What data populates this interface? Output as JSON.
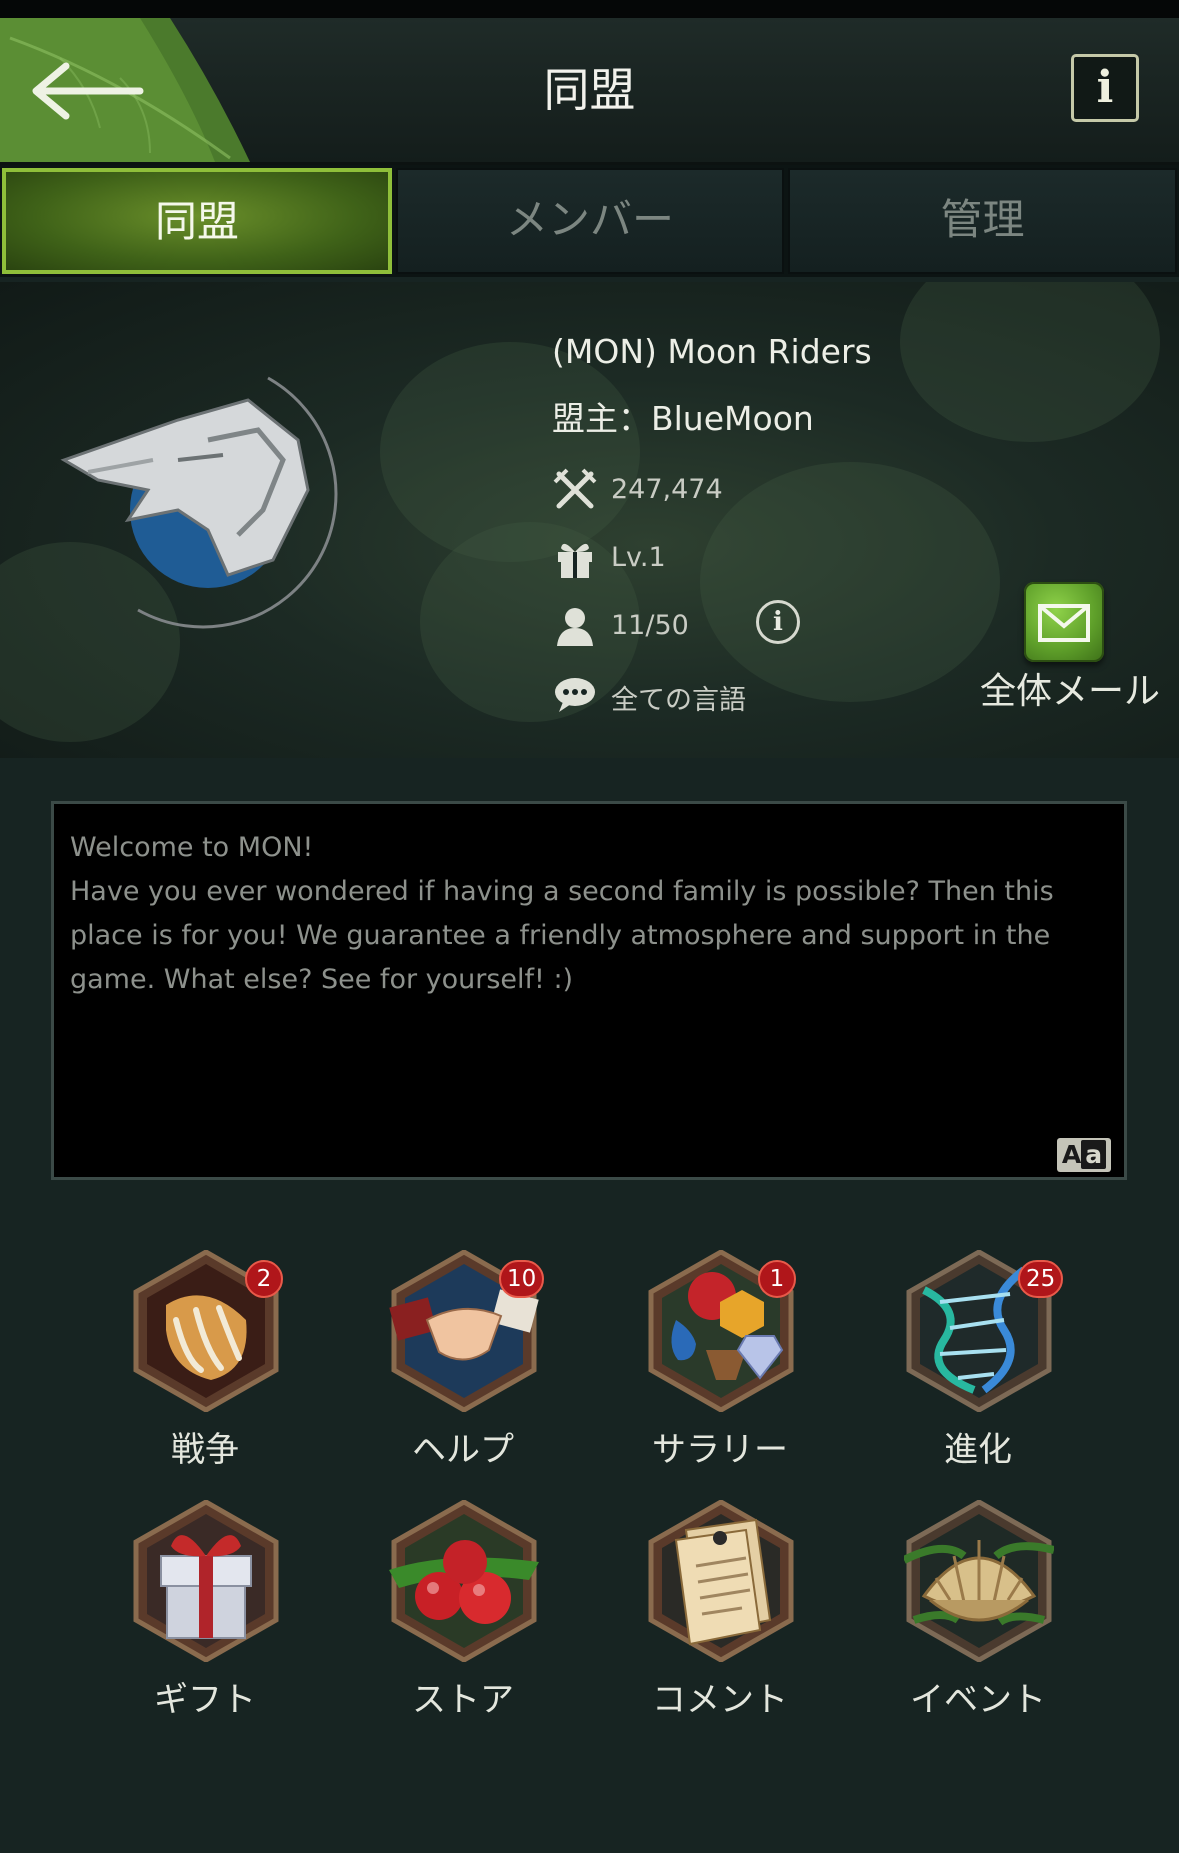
{
  "header": {
    "title": "同盟",
    "back_icon": "arrow-left-icon",
    "info_icon_glyph": "i"
  },
  "tabs": [
    {
      "label": "同盟",
      "active": true
    },
    {
      "label": "メンバー",
      "active": false
    },
    {
      "label": "管理",
      "active": false
    }
  ],
  "alliance": {
    "name": "(MON) Moon Riders",
    "leader": "盟主：BlueMoon",
    "power": "247,474",
    "level": "Lv.1",
    "members": "11/50",
    "language": "全ての言語",
    "member_info_glyph": "i",
    "mail_label": "全体メール"
  },
  "description": {
    "text": "Welcome to MON!\nHave you ever wondered if having a second family is possible? Then this place is for you! We guarantee a friendly atmosphere and support in the game. What else? See for yourself! :)",
    "translate_a": "A",
    "translate_b": "a"
  },
  "features": [
    {
      "label": "戦争",
      "badge": "2",
      "icon": "claw-icon"
    },
    {
      "label": "ヘルプ",
      "badge": "10",
      "icon": "handshake-icon"
    },
    {
      "label": "サラリー",
      "badge": "1",
      "icon": "resources-icon"
    },
    {
      "label": "進化",
      "badge": "25",
      "icon": "dna-icon"
    },
    {
      "label": "ギフト",
      "badge": "",
      "icon": "gift-box-icon"
    },
    {
      "label": "ストア",
      "badge": "",
      "icon": "apples-icon"
    },
    {
      "label": "コメント",
      "badge": "",
      "icon": "notepad-icon"
    },
    {
      "label": "イベント",
      "badge": "",
      "icon": "shell-icon"
    }
  ],
  "colors": {
    "active_tab": "#4a7a1e",
    "badge": "#b0161a",
    "background": "#172422"
  }
}
